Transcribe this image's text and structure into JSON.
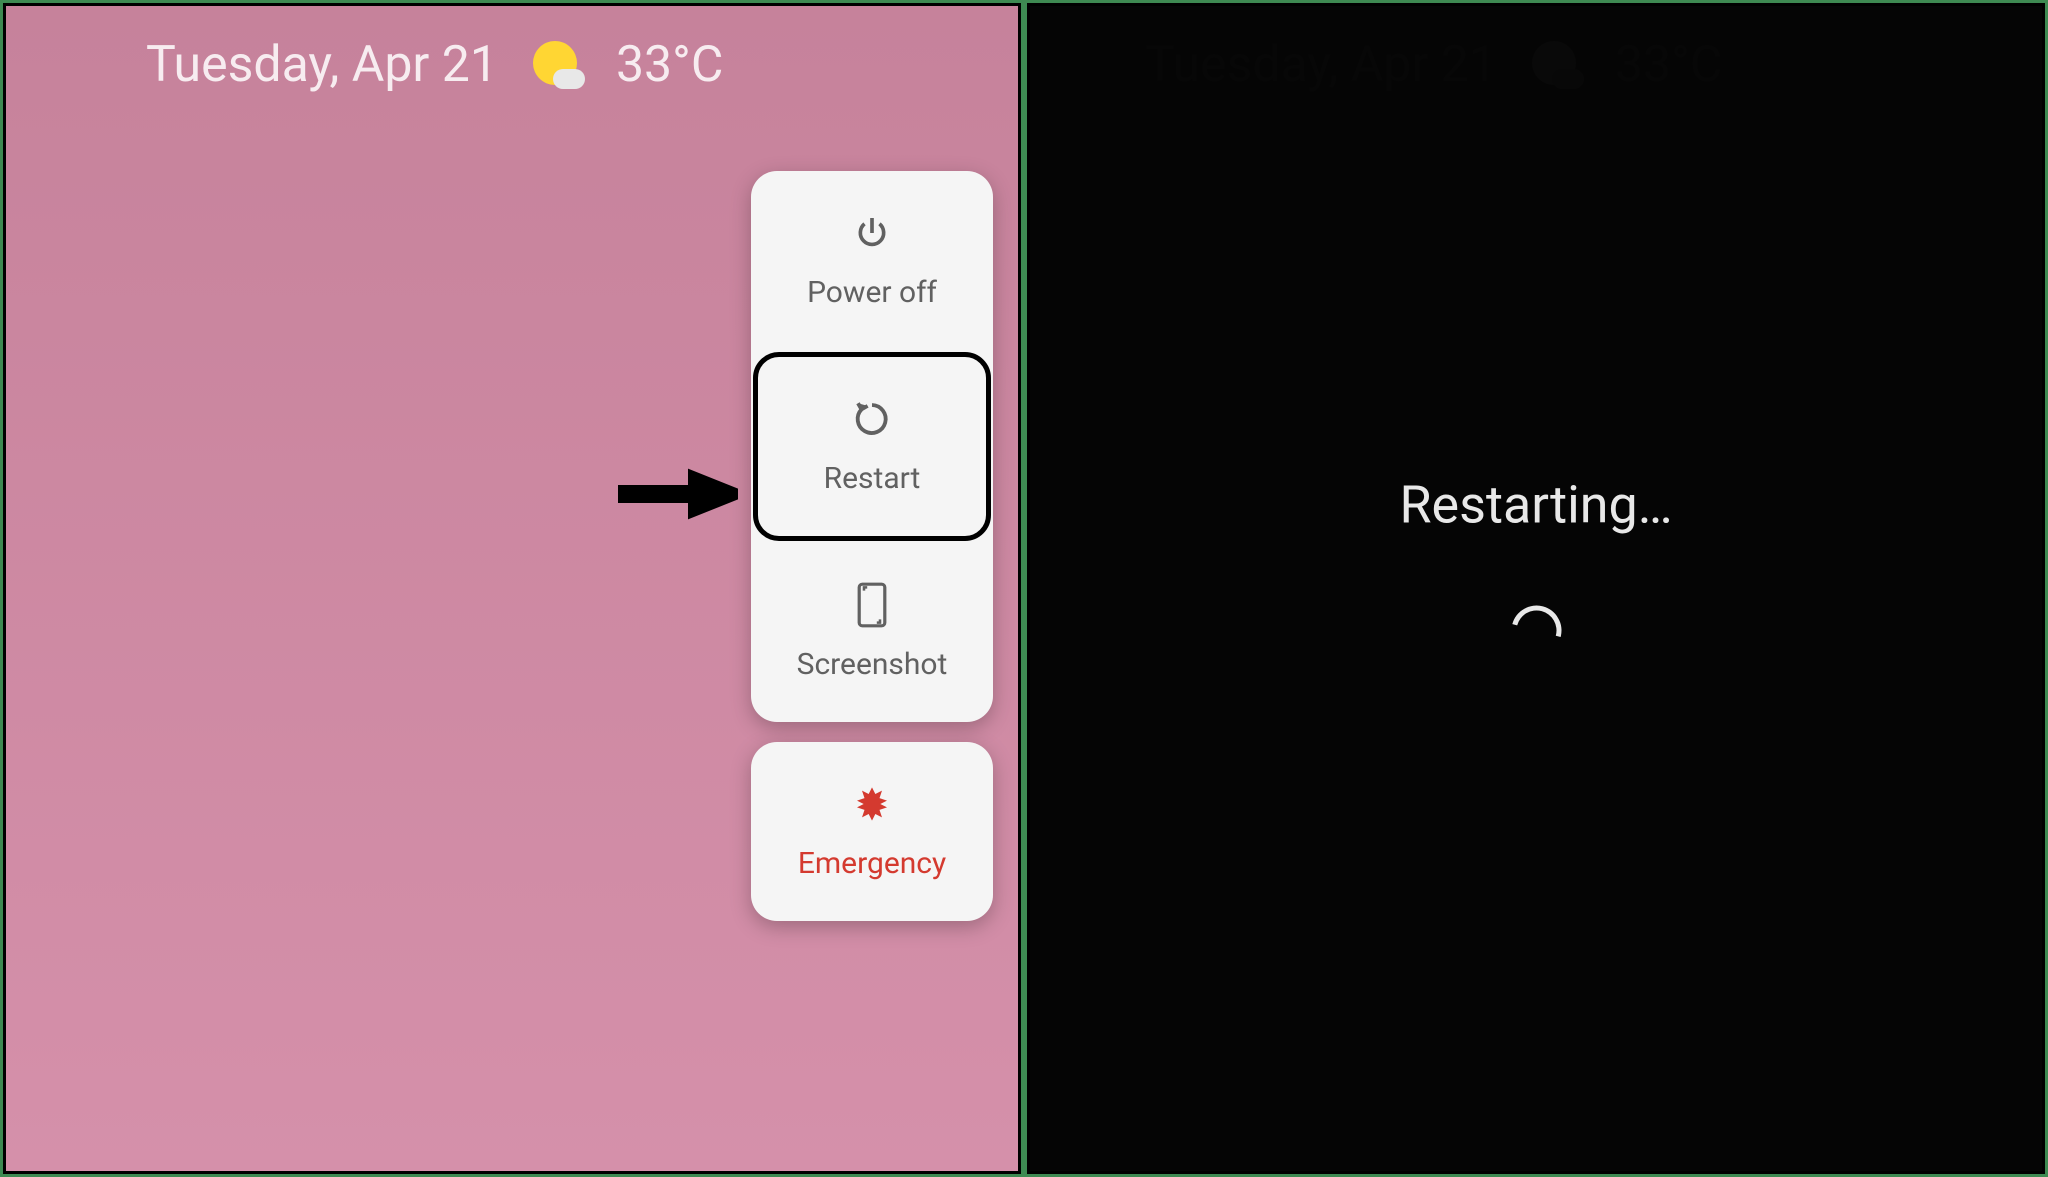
{
  "status_bar": {
    "date": "Tuesday, Apr 21",
    "temperature": "33°C"
  },
  "power_menu": {
    "items": [
      {
        "label": "Power off",
        "icon": "power-icon"
      },
      {
        "label": "Restart",
        "icon": "restart-icon",
        "highlighted": true
      },
      {
        "label": "Screenshot",
        "icon": "screenshot-icon"
      }
    ],
    "emergency": {
      "label": "Emergency",
      "icon": "emergency-icon",
      "color": "#d43a2f"
    }
  },
  "restarting": {
    "label": "Restarting…"
  }
}
